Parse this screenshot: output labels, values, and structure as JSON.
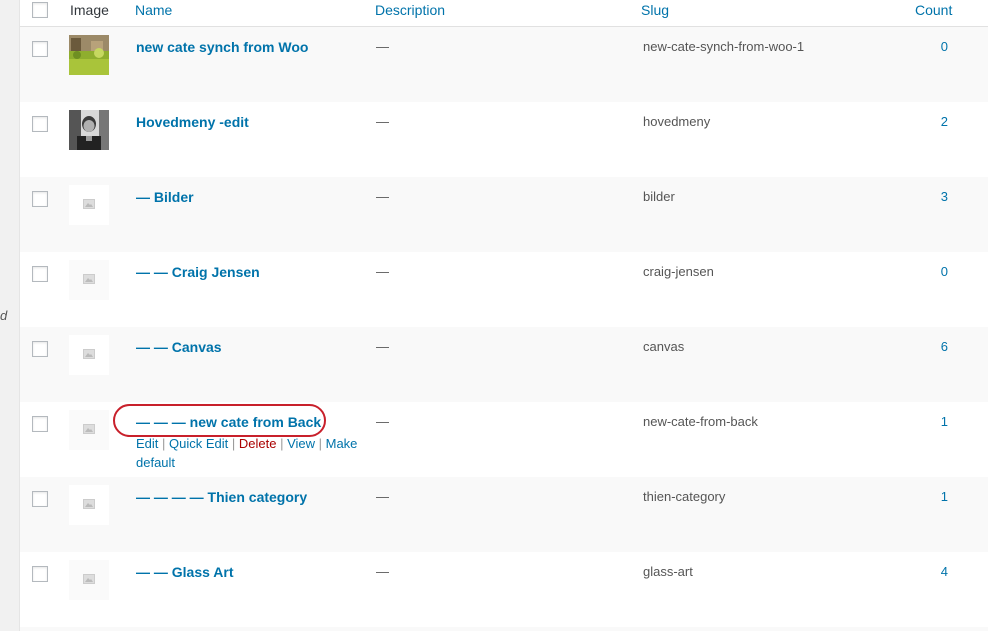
{
  "sidebar": {
    "cut_text": "d"
  },
  "table": {
    "headers": {
      "image": "Image",
      "name": "Name",
      "description": "Description",
      "slug": "Slug",
      "count": "Count"
    },
    "rows": [
      {
        "name": "new cate synch from Woo",
        "description": "—",
        "slug": "new-cate-synch-from-woo-1",
        "count": "0",
        "image": "photo-garden"
      },
      {
        "name": "Hovedmeny -edit",
        "description": "—",
        "slug": "hovedmeny",
        "count": "2",
        "image": "photo-person"
      },
      {
        "name": "— Bilder",
        "description": "—",
        "slug": "bilder",
        "count": "3",
        "image": "placeholder"
      },
      {
        "name": "— — Craig Jensen",
        "description": "—",
        "slug": "craig-jensen",
        "count": "0",
        "image": "placeholder"
      },
      {
        "name": "— — Canvas",
        "description": "—",
        "slug": "canvas",
        "count": "6",
        "image": "placeholder"
      },
      {
        "name": "— — — new cate from Back",
        "description": "—",
        "slug": "new-cate-from-back",
        "count": "1",
        "image": "placeholder"
      },
      {
        "name": "— — — — Thien category",
        "description": "—",
        "slug": "thien-category",
        "count": "1",
        "image": "placeholder"
      },
      {
        "name": "— — Glass Art",
        "description": "—",
        "slug": "glass-art",
        "count": "4",
        "image": "placeholder"
      }
    ]
  },
  "row_actions": {
    "edit": "Edit",
    "quick_edit": "Quick Edit",
    "delete": "Delete",
    "view": "View",
    "make_default": "Make default",
    "separator": " | "
  },
  "colors": {
    "link": "#0073aa",
    "delete": "#aa0000",
    "highlight_circle": "#c8202b"
  }
}
